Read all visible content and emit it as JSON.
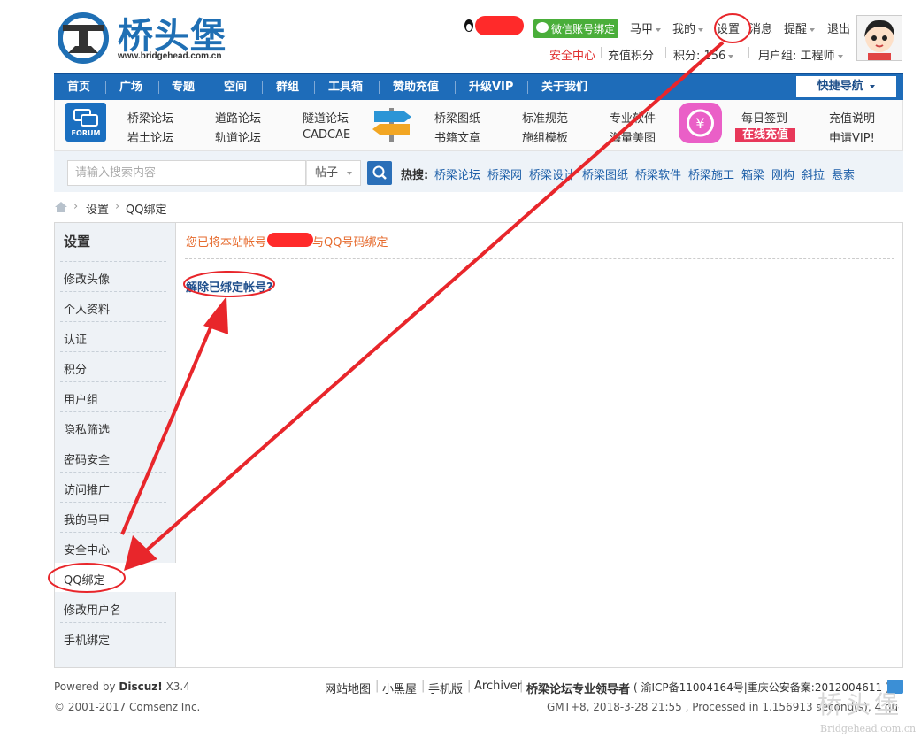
{
  "logo": {
    "brand": "桥头堡",
    "url": "www.bridgehead.com.cn"
  },
  "userbar": {
    "wechat": "微信账号绑定",
    "username": "马甲",
    "mine": "我的",
    "settings": "设置",
    "messages": "消息",
    "reminders": "提醒",
    "logout": "退出",
    "security_center": "安全中心",
    "recharge_points": "充值积分",
    "points": "积分: 156",
    "user_group": "用户组: 工程师"
  },
  "nav": {
    "items": [
      "首页",
      "广场",
      "专题",
      "空间",
      "群组",
      "工具箱",
      "赞助充值",
      "升级VIP",
      "关于我们"
    ],
    "quick_nav": "快捷导航"
  },
  "subnav": {
    "forum_icon": "FORUM",
    "col1": [
      "桥梁论坛",
      "岩土论坛"
    ],
    "col2": [
      "道路论坛",
      "轨道论坛"
    ],
    "col3": [
      "隧道论坛",
      "CADCAE"
    ],
    "col4": [
      "桥梁图纸",
      "书籍文章"
    ],
    "col5": [
      "标准规范",
      "施组模板"
    ],
    "col6": [
      "专业软件",
      "海量美图"
    ],
    "col7": [
      "每日签到",
      "在线充值"
    ],
    "col8": [
      "充值说明",
      "申请VIP!"
    ]
  },
  "search": {
    "placeholder": "请输入搜索内容",
    "type": "帖子",
    "hot_label": "热搜:",
    "hot": [
      "桥梁论坛",
      "桥梁网",
      "桥梁设计",
      "桥梁图纸",
      "桥梁软件",
      "桥梁施工",
      "箱梁",
      "刚构",
      "斜拉",
      "悬索"
    ]
  },
  "breadcrumb": {
    "settings": "设置",
    "current": "QQ绑定"
  },
  "sidebar": {
    "title": "设置",
    "items": [
      "修改头像",
      "个人资料",
      "认证",
      "积分",
      "用户组",
      "隐私筛选",
      "密码安全",
      "访问推广",
      "我的马甲",
      "安全中心",
      "QQ绑定",
      "修改用户名",
      "手机绑定"
    ]
  },
  "content": {
    "notice_prefix": "您已将本站帐号",
    "notice_suffix": "与QQ号码绑定",
    "unbind": "解除已绑定帐号?"
  },
  "footer": {
    "powered_by": "Powered by",
    "discuz": "Discuz!",
    "version": "X3.4",
    "copyright": "© 2001-2017 Comsenz Inc.",
    "links": [
      "网站地图",
      "小黑屋",
      "手机版",
      "Archiver"
    ],
    "slogan": "桥梁论坛专业领导者",
    "icp": "( 渝ICP备11004164号|重庆公安备案:2012004611 )",
    "timing": "GMT+8, 2018-3-28 21:55 , Processed in 1.156913 second(s), 4 queries .",
    "watermark": "Bridgehead.com.cn"
  },
  "colors": {
    "nav_blue": "#1e6cb9",
    "annotation_red": "#e8262b",
    "notice_orange": "#e66a2c"
  }
}
